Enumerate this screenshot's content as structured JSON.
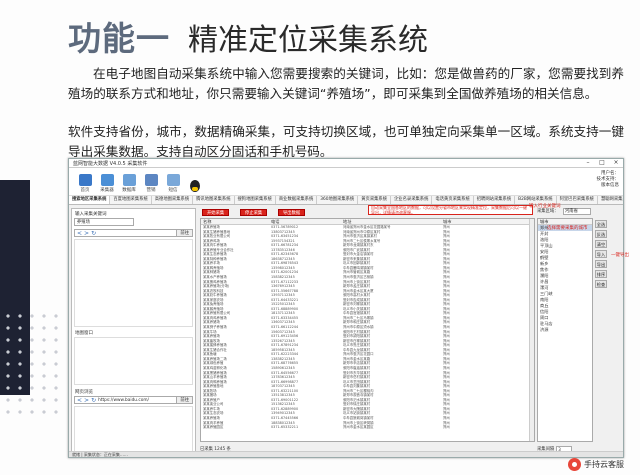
{
  "slide": {
    "title_prefix": "功能一",
    "title_main": "精准定位采集系统",
    "paragraph1": "在电子地图自动采集系统中输入您需要搜索的关键词，比如：您是做兽药的厂家，您需要找到养殖场的联系方式和地址，你只需要输入关键词“养殖场”，即可采集到全国做养殖场的相关信息。",
    "paragraph2": "软件支持省份，城市，数据精确采集，可支持切换区域，也可单独定向采集单一区域。系统支持一键导出采集数据。支持自动区分固话和手机号码。",
    "watermark": "手持云客服"
  },
  "app": {
    "window_title": "蓝网智能大数据 V4.0.5 采集软件",
    "toolbar": [
      {
        "label": "首页",
        "icon": "home-icon",
        "color": "#3a78c8"
      },
      {
        "label": "采集器",
        "icon": "collector-icon",
        "color": "#4b8fd6"
      },
      {
        "label": "数据库",
        "icon": "database-icon",
        "color": "#6aa0d8"
      },
      {
        "label": "营销",
        "icon": "mail-icon",
        "color": "#5c86c2"
      },
      {
        "label": "短信",
        "icon": "sms-icon",
        "color": "#7aa8d9"
      },
      {
        "label": "",
        "icon": "qq-icon",
        "color": "#222222"
      }
    ],
    "toolbar_right": [
      "用户名：",
      "技术支持：",
      "版本信息"
    ],
    "tabs": [
      "搜索地区采集系统",
      "百度地图采集系统",
      "高德地图采集系统",
      "腾讯地图采集系统",
      "搜狗地图采集系统",
      "商业数据采集系统",
      "360地图采集系统",
      "黄页采集系统",
      "企业名录采集系统",
      "电话黄页采集系统",
      "招聘网站采集系统",
      "B2B网站采集系统",
      "阿里巴巴采集系统",
      "慧聪网采集系统",
      "商机网采集系统",
      "1688采集系统",
      "工商信息采集系统",
      "微信群采集系统",
      "QQ群采集系统",
      "天眼查采集"
    ],
    "active_tab": 0,
    "left": {
      "search_label": "输入采集关键词",
      "search_value": "养殖场",
      "addr1_value": "",
      "go_label": "前往",
      "label2": "地图窗口",
      "label3": "网页浏览",
      "addr3_value": "https://www.baidu.com/",
      "nav_back": "<",
      "nav_fwd": ">",
      "nav_refresh": "↻"
    },
    "center": {
      "buttons": [
        "开始采集",
        "停止采集",
        "导出数据"
      ],
      "annotation": "自动采集全国各地区的数据，可以设置分省市地区来实现精准定位，采集数据后可以一键导出，详情请咨询客服。",
      "columns": [
        "名称",
        "电话",
        "地址",
        "城市"
      ],
      "rows": [
        [
          "某某养殖场",
          "0371-56789012",
          "河南省郑州市金水区花园路某号",
          "郑州"
        ],
        [
          "某某生猪养殖基地",
          "13803712345",
          "河南省郑州市中原区某村",
          "郑州"
        ],
        [
          "某某牧业有限公司",
          "0371-63451234",
          "郑州市惠济区某镇某村",
          "郑州"
        ],
        [
          "某某养鸡场",
          "15937154321",
          "郑州市二七区侯寨乡某号",
          "郑州"
        ],
        [
          "某某肉牛养殖场",
          "0371-66781234",
          "新郑市龙湖镇某村东",
          "郑州"
        ],
        [
          "某某养殖专业合作社",
          "13783512346",
          "荥阳市广武镇某村",
          "郑州"
        ],
        [
          "某某生态养殖场",
          "0371-62345678",
          "登封市大金店镇某村",
          "郑州"
        ],
        [
          "某某特种养殖场",
          "18638712345",
          "新密市来集镇某村",
          "郑州"
        ],
        [
          "某某养羊场",
          "0371-69876543",
          "巩义市回郭镇某村",
          "郑州"
        ],
        [
          "某某鸭养殖场",
          "13598012345",
          "中牟县雁鸣湖镇某村",
          "郑州"
        ],
        [
          "某某种猪场",
          "0371-62001234",
          "郑州市管城区某路",
          "郑州"
        ],
        [
          "某某水产养殖场",
          "15838212345",
          "郑州市惠济区古荥镇",
          "郑州"
        ],
        [
          "某某蛋鸡养殖场",
          "0371-67112233",
          "郑州市上街区某村",
          "郑州"
        ],
        [
          "某某养殖场(分场)",
          "13676912345",
          "新郑市孟庄镇某村",
          "郑州"
        ],
        [
          "某某农牧科技",
          "0371-55667788",
          "郑州市金水区某大厦",
          "郑州"
        ],
        [
          "某某奶牛养殖场",
          "13937112345",
          "荥阳市高村乡某村",
          "郑州"
        ],
        [
          "某某家庭农场",
          "0371-64433221",
          "登封市告成镇某村",
          "郑州"
        ],
        [
          "某某兔养殖场",
          "15225012345",
          "新密市刘寨镇某村",
          "郑州"
        ],
        [
          "某某鹅养殖场",
          "0371-68889900",
          "巩义市小关镇某村",
          "郑州"
        ],
        [
          "某某养殖有限公司",
          "18137112345",
          "中牟县官渡镇某村",
          "郑州"
        ],
        [
          "某某肉鸡养殖场",
          "0371-63334455",
          "郑州市二七区马寨镇",
          "郑州"
        ],
        [
          "某某养猪场",
          "13603712345",
          "新郑市和庄镇某村",
          "郑州"
        ],
        [
          "某某鸽子养殖场",
          "0371-66112244",
          "郑州市中原区须水镇",
          "郑州"
        ],
        [
          "某某牛场",
          "15603712345",
          "荥阳市王村镇某村",
          "郑州"
        ],
        [
          "某某养殖场",
          "0371-69123456",
          "登封市颍阳镇某村",
          "郑州"
        ],
        [
          "某某畜牧场",
          "13526712345",
          "新密市白寨镇某村",
          "郑州"
        ],
        [
          "某某蜜蜂养殖场",
          "0371-67891234",
          "巩义市鲁庄镇某村",
          "郑州"
        ],
        [
          "某某生猪合作社",
          "18595812345",
          "中牟县九龙镇某村",
          "郑州"
        ],
        [
          "某某鱼塘",
          "0371-62223344",
          "郑州市惠济区花园口",
          "郑州"
        ],
        [
          "某某养殖场二场",
          "13838212345",
          "郑州市金水区某路",
          "郑州"
        ],
        [
          "某某绿色养殖",
          "0371-68776655",
          "新郑市辛店镇某村",
          "郑州"
        ],
        [
          "某某鸡苗孵化场",
          "15890612345",
          "荥阳市崔庙镇某村",
          "郑州"
        ],
        [
          "某某黑猪养殖场",
          "0371-64556677",
          "登封市东华镇某村",
          "郑州"
        ],
        [
          "某某山羊养殖场",
          "13783612345",
          "新密市岳村镇某村",
          "郑州"
        ],
        [
          "某某肉鸭养殖场",
          "0371-66998877",
          "巩义市芝田镇某村",
          "郑州"
        ],
        [
          "某某养殖基地",
          "18703712345",
          "中牟县刘集镇某村",
          "郑州"
        ],
        [
          "某某牧场",
          "0371-63221100",
          "郑州市二七区樱桃沟",
          "郑州"
        ],
        [
          "某某猪场",
          "13513812345",
          "新郑市观音寺镇某村",
          "郑州"
        ],
        [
          "某某养殖户",
          "0371-69001122",
          "荥阳市汜水镇某村",
          "郑州"
        ],
        [
          "某某禽业公司",
          "15136212345",
          "登封市徐庄镇某村",
          "郑州"
        ],
        [
          "某某养牛场",
          "0371-62889900",
          "新密市大隗镇某村",
          "郑州"
        ],
        [
          "某某生态农场",
          "13949012345",
          "巩义市站街镇某村",
          "郑州"
        ],
        [
          "某某养殖场",
          "0371-67445566",
          "中牟县狼城岗镇某村",
          "郑州"
        ],
        [
          "某某肉羊养殖",
          "18838012345",
          "郑州市上街区峡窝镇",
          "郑州"
        ],
        [
          "某某养殖园区",
          "0371-65332211",
          "郑州市金水区某园区",
          "郑州"
        ]
      ],
      "bottom_label": "已采集 1245 条"
    },
    "right": {
      "area_label": "采集区域：",
      "area_value": "河南省",
      "list_header": "城市",
      "cities": [
        "郑州",
        "开封",
        "洛阳",
        "平顶山",
        "安阳",
        "鹤壁",
        "新乡",
        "焦作",
        "濮阳",
        "许昌",
        "漯河",
        "三门峡",
        "南阳",
        "商丘",
        "信阳",
        "周口",
        "驻马店",
        "济源"
      ],
      "selected_city": 0,
      "buttons": [
        "全选",
        "反选",
        "清空",
        "导入",
        "导出",
        "排序",
        "检查"
      ],
      "annotations": [
        "输入行业关键词",
        "选择需要采集的城市",
        "一键导出"
      ],
      "footer_label": "采集间隔",
      "footer_value": "3"
    },
    "status": "就绪 | 采集状态：正在采集……"
  }
}
